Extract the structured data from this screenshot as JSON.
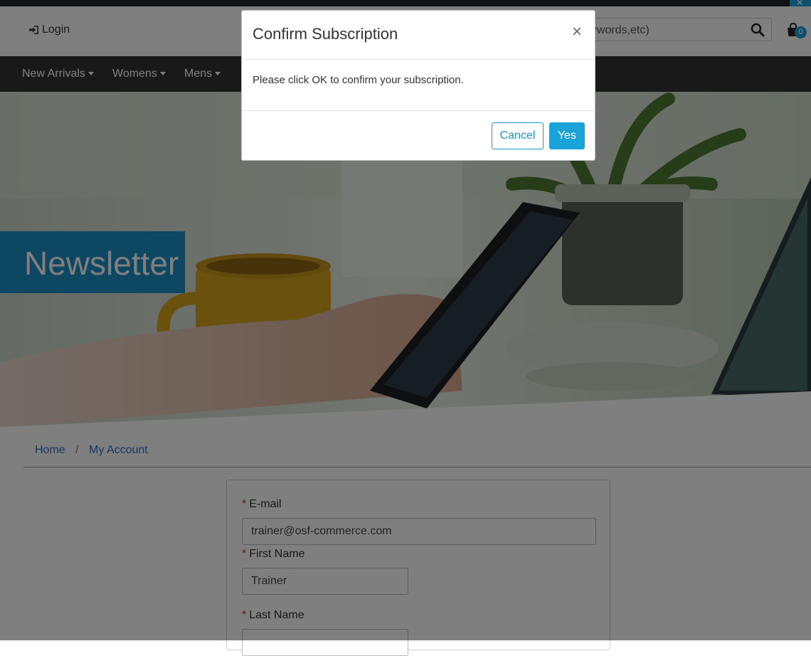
{
  "header": {
    "login_label": "Login",
    "search_placeholder": "keywords,etc)",
    "cart_count": "0"
  },
  "nav": {
    "items": [
      {
        "label": "New Arrivals"
      },
      {
        "label": "Womens"
      },
      {
        "label": "Mens"
      }
    ]
  },
  "hero": {
    "title": "Newsletter"
  },
  "breadcrumb": {
    "items": [
      "Home",
      "My Account"
    ],
    "separator": "/"
  },
  "form": {
    "email_label": "E-mail",
    "email_value": "trainer@osf-commerce.com",
    "first_name_label": "First Name",
    "first_name_value": "Trainer",
    "last_name_label": "Last Name",
    "required_marker": "*"
  },
  "modal": {
    "title": "Confirm Subscription",
    "close_glyph": "×",
    "body": "Please click OK to confirm your subscription.",
    "cancel_label": "Cancel",
    "yes_label": "Yes"
  },
  "colors": {
    "accent": "#1aa3d8",
    "nav_bg": "#333333",
    "link": "#2a6ebd",
    "hero_banner": "#1a8fc4"
  }
}
